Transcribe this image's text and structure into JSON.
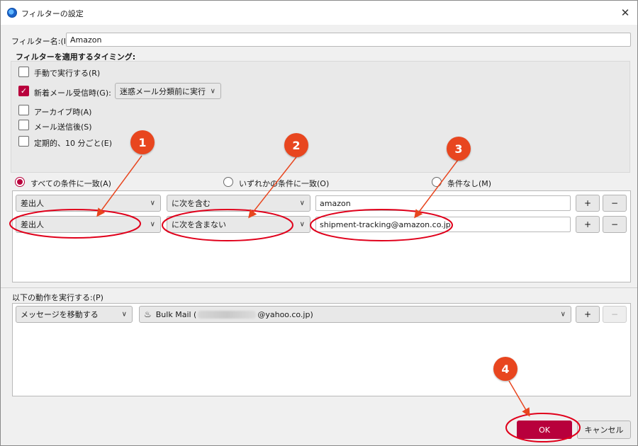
{
  "window": {
    "title": "フィルターの設定",
    "close_glyph": "✕"
  },
  "filter_name": {
    "label": "フィルター名:(I)",
    "value": "Amazon"
  },
  "timing": {
    "heading": "フィルターを適用するタイミング:",
    "options": [
      {
        "label": "手動で実行する(R)",
        "checked": false
      },
      {
        "label": "新着メール受信時(G):",
        "checked": true
      },
      {
        "label": "アーカイブ時(A)",
        "checked": false
      },
      {
        "label": "メール送信後(S)",
        "checked": false
      },
      {
        "label": "定期的、10 分ごと(E)",
        "checked": false
      }
    ],
    "new_mail_select": "迷惑メール分類前に実行"
  },
  "match": {
    "options": [
      "すべての条件に一致(A)",
      "いずれかの条件に一致(O)",
      "条件なし(M)"
    ],
    "selected_index": 0
  },
  "rules": [
    {
      "field": "差出人",
      "operator": "に次を含む",
      "value": "amazon"
    },
    {
      "field": "差出人",
      "operator": "に次を含まない",
      "value": "shipment-tracking@amazon.co.jp"
    }
  ],
  "actions": {
    "heading": "以下の動作を実行する:(P)",
    "items": [
      {
        "action": "メッセージを移動する",
        "target_prefix": "Bulk Mail (",
        "target_suffix": "@yahoo.co.jp)"
      }
    ]
  },
  "buttons": {
    "add": "+",
    "remove": "−",
    "ok": "OK",
    "cancel": "キャンセル"
  },
  "annotations": [
    "1",
    "2",
    "3",
    "4"
  ],
  "colors": {
    "accent": "#b8003c",
    "annotation": "#e8461f"
  }
}
